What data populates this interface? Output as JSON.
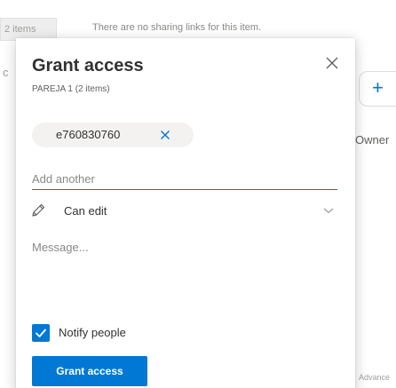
{
  "background": {
    "items_tab_label": "2 items",
    "sharing_notice": "There are no sharing links for this item.",
    "truncated_left_glyph": "c",
    "add_tab_icon": "plus-icon",
    "owner_label": "Owner",
    "bottom_right_text": "Advance"
  },
  "dialog": {
    "title": "Grant access",
    "subtitle": "PAREJA 1 (2 items)",
    "close_icon": "close-icon",
    "recipient_chip": {
      "label": "e760830760",
      "remove_icon": "close-icon"
    },
    "add_another": {
      "value": "",
      "placeholder": "Add another"
    },
    "permission": {
      "icon": "pencil-icon",
      "selected": "Can edit",
      "dropdown_icon": "chevron-down-icon"
    },
    "message": {
      "value": "",
      "placeholder": "Message..."
    },
    "notify": {
      "label": "Notify people",
      "checked": true
    },
    "primary_button_label": "Grant access"
  },
  "colors": {
    "accent": "#0078d4",
    "text_primary": "#323130",
    "text_secondary": "#605e5c",
    "placeholder": "#8a8886",
    "chip_background": "#f3f2f1"
  }
}
